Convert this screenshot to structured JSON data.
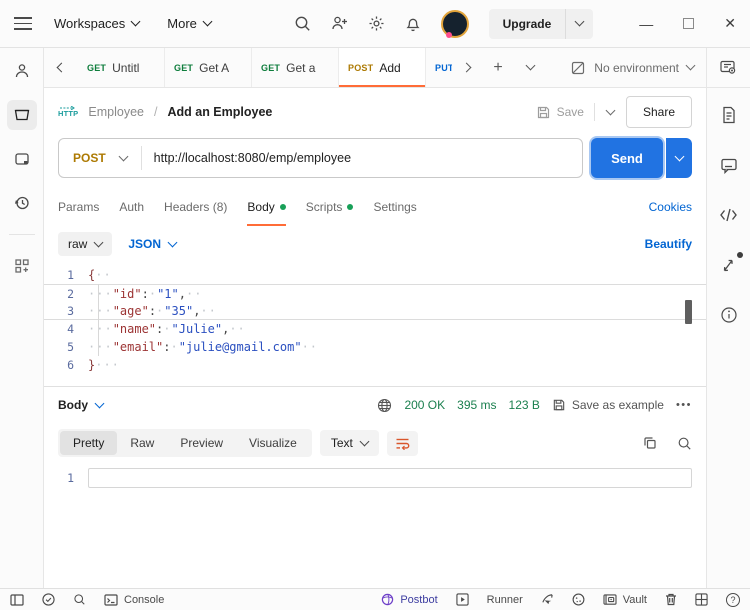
{
  "header": {
    "workspaces": "Workspaces",
    "more": "More",
    "upgrade": "Upgrade"
  },
  "icons": {
    "plus": "+",
    "minimize": "—",
    "close": "✕",
    "more_dots": "•••",
    "question": "?",
    "http_badge": "HTTP"
  },
  "tabs": {
    "items": [
      {
        "method": "GET",
        "label": "Untitl"
      },
      {
        "method": "GET",
        "label": "Get A"
      },
      {
        "method": "GET",
        "label": "Get a"
      },
      {
        "method": "POST",
        "label": "Add"
      },
      {
        "method": "PUT",
        "label": ""
      }
    ],
    "environment": "No environment"
  },
  "request": {
    "collection": "Employee",
    "separator": "/",
    "name": "Add an Employee",
    "save": "Save",
    "share": "Share",
    "method": "POST",
    "url": "http://localhost:8080/emp/employee",
    "send": "Send",
    "tab_params": "Params",
    "tab_auth": "Auth",
    "tab_headers": "Headers (8)",
    "tab_body": "Body",
    "tab_scripts": "Scripts",
    "tab_settings": "Settings",
    "cookies": "Cookies",
    "mode": "raw",
    "language": "JSON",
    "beautify": "Beautify"
  },
  "editor": {
    "highlight_box": {
      "from": 2,
      "to": 3
    },
    "lines": [
      {
        "n": "1",
        "tokens": [
          {
            "t": "b",
            "s": "{"
          },
          {
            "t": "w",
            "s": "··"
          }
        ]
      },
      {
        "n": "2",
        "tokens": [
          {
            "t": "w",
            "s": "···"
          },
          {
            "t": "k",
            "s": "\"id\""
          },
          {
            "t": "p",
            "s": ":"
          },
          {
            "t": "w",
            "s": "·"
          },
          {
            "t": "v",
            "s": "\"1\""
          },
          {
            "t": "p",
            "s": ","
          },
          {
            "t": "w",
            "s": "··"
          }
        ]
      },
      {
        "n": "3",
        "tokens": [
          {
            "t": "w",
            "s": "···"
          },
          {
            "t": "k",
            "s": "\"age\""
          },
          {
            "t": "p",
            "s": ":"
          },
          {
            "t": "w",
            "s": "·"
          },
          {
            "t": "v",
            "s": "\"35\""
          },
          {
            "t": "p",
            "s": ","
          },
          {
            "t": "w",
            "s": "··"
          }
        ]
      },
      {
        "n": "4",
        "tokens": [
          {
            "t": "w",
            "s": "···"
          },
          {
            "t": "k",
            "s": "\"name\""
          },
          {
            "t": "p",
            "s": ":"
          },
          {
            "t": "w",
            "s": "·"
          },
          {
            "t": "v",
            "s": "\"Julie\""
          },
          {
            "t": "p",
            "s": ","
          },
          {
            "t": "w",
            "s": "··"
          }
        ]
      },
      {
        "n": "5",
        "tokens": [
          {
            "t": "w",
            "s": "···"
          },
          {
            "t": "k",
            "s": "\"email\""
          },
          {
            "t": "p",
            "s": ":"
          },
          {
            "t": "w",
            "s": "·"
          },
          {
            "t": "v",
            "s": "\"julie@gmail.com\""
          },
          {
            "t": "w",
            "s": "··"
          }
        ]
      },
      {
        "n": "6",
        "tokens": [
          {
            "t": "b",
            "s": "}"
          },
          {
            "t": "w",
            "s": "···"
          }
        ]
      }
    ]
  },
  "response": {
    "body": "Body",
    "status": "200 OK",
    "time": "395 ms",
    "size": "123 B",
    "save_example": "Save as example",
    "views": [
      "Pretty",
      "Raw",
      "Preview",
      "Visualize"
    ],
    "active_view": "Pretty",
    "format": "Text",
    "line": "1"
  },
  "footer": {
    "console": "Console",
    "postbot": "Postbot",
    "runner": "Runner",
    "vault": "Vault"
  },
  "colors": {
    "accent_orange": "#ff6c37",
    "get_green": "#0e7d3c",
    "post_amber": "#ad7a03",
    "put_blue": "#0265d2",
    "link_blue": "#0265d2",
    "success_green": "#1a7f4e",
    "send_blue": "#2173e2",
    "status_dot_green": "#18a058"
  }
}
